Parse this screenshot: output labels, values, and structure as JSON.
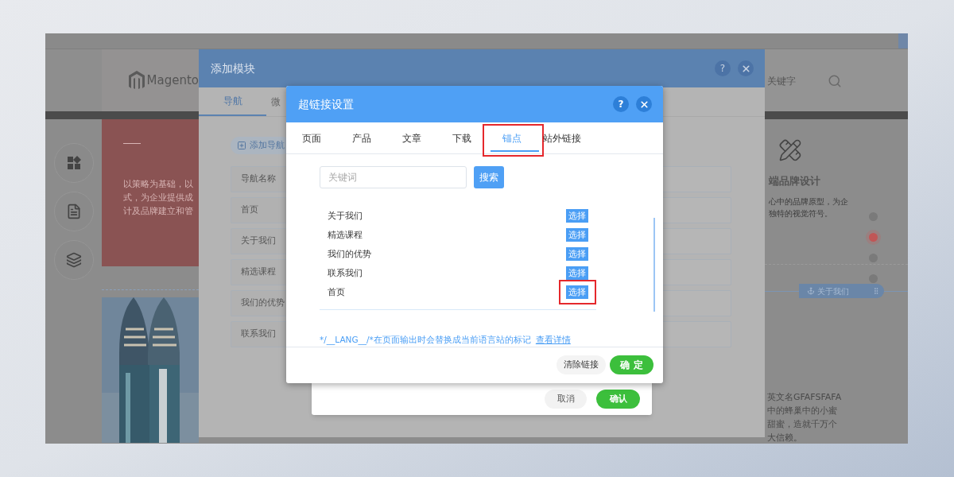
{
  "background_page": {
    "logo": "Magento",
    "banner_lines": [
      "以策略为基础，以",
      "式，为企业提供成",
      "计及品牌建立和管"
    ],
    "search_placeholder": "关键字",
    "service_title": "端品牌设计",
    "service_lines": [
      "心中的品牌原型，为企",
      "独特的视觉符号。"
    ],
    "anchor_tag": "关于我们",
    "about_lines": [
      "英文名GFAFSFAFA",
      "中的蜂巢中的小蜜",
      "甜蜜，造就千万个",
      "大信赖。"
    ],
    "slide_dots": [
      {
        "selected": false
      },
      {
        "selected": true
      },
      {
        "selected": false
      },
      {
        "selected": false
      }
    ]
  },
  "module_dialog": {
    "title": "添加模块",
    "help_button": "?",
    "tabs": [
      {
        "label": "导航",
        "selected": true
      },
      {
        "label": "微",
        "selected": false
      }
    ],
    "add_button": "添加导航",
    "rows": [
      "导航名称",
      "首页",
      "关于我们",
      "精选课程",
      "我们的优势",
      "联系我们"
    ],
    "cancel_button": "取消",
    "confirm_button": "确认"
  },
  "link_dialog": {
    "title": "超链接设置",
    "help_button": "?",
    "tabs": [
      {
        "label": "页面",
        "selected": false,
        "highlighted": false
      },
      {
        "label": "产品",
        "selected": false,
        "highlighted": false
      },
      {
        "label": "文章",
        "selected": false,
        "highlighted": false
      },
      {
        "label": "下载",
        "selected": false,
        "highlighted": false
      },
      {
        "label": "锚点",
        "selected": true,
        "highlighted": true
      },
      {
        "label": "站外链接",
        "selected": false,
        "highlighted": false
      }
    ],
    "search": {
      "placeholder": "关键词",
      "button": "搜索"
    },
    "anchors": [
      {
        "name": "关于我们",
        "action": "选择",
        "highlighted": false
      },
      {
        "name": "精选课程",
        "action": "选择",
        "highlighted": false
      },
      {
        "name": "我们的优势",
        "action": "选择",
        "highlighted": false
      },
      {
        "name": "联系我们",
        "action": "选择",
        "highlighted": false
      },
      {
        "name": "首页",
        "action": "选择",
        "highlighted": true
      }
    ],
    "note": "*/__LANG__/*在页面输出时会替换成当前语言站的标记",
    "note_link": "查看详情",
    "clear_button": "清除链接",
    "ok_button": "确 定"
  }
}
